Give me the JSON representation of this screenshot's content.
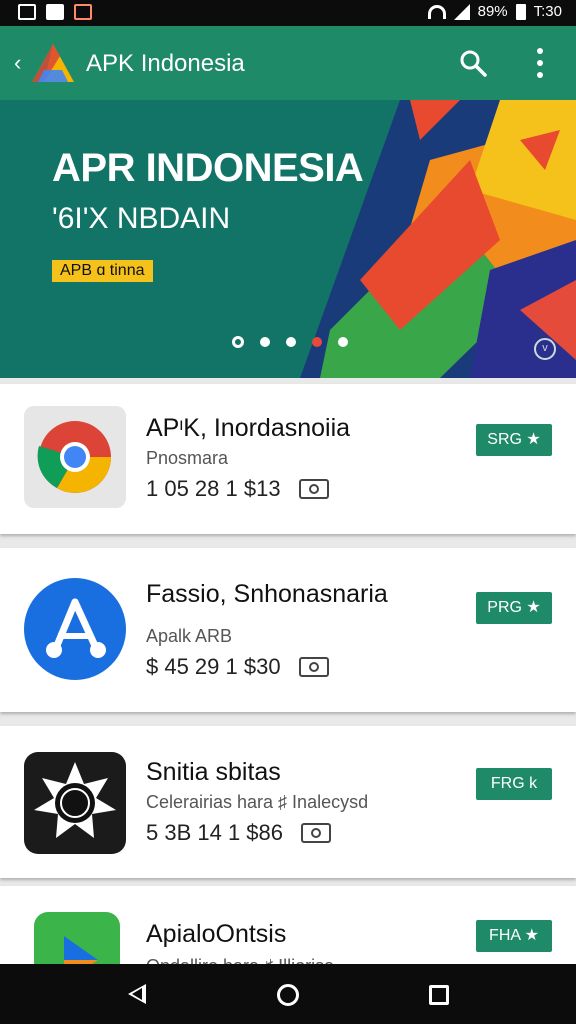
{
  "status_bar": {
    "battery": "89%",
    "time": "T:30"
  },
  "app_bar": {
    "title": "APK Indonesia"
  },
  "banner": {
    "title": "APR INDONESIA",
    "subtitle": "'6I'X NBDAIN",
    "tag": "APB ɑ tinna"
  },
  "apps": [
    {
      "name": "APᶦK, Inordasnoiia",
      "developer": "Pnosmara",
      "meta": "1 05 28 1 $13",
      "button": "SRG ★"
    },
    {
      "name": "Fassio, Snhonasnaria",
      "developer": "Apalk ARB",
      "meta": "$ 45 29 1 $30",
      "button": "PRG ★"
    },
    {
      "name": "Snitia sbitas",
      "developer": "Celerairias hara ♯ Inalecysd",
      "meta": "5 3B 14 1 $86",
      "button": "FRG k"
    },
    {
      "name": "ApialoOntsis",
      "developer": "Ondalliro hara ♯ Illiorisa",
      "meta": "",
      "button": "FHA ★"
    }
  ],
  "colors": {
    "primary": "#1f8a67",
    "banner": "#127466"
  },
  "icons": [
    "back-icon",
    "search-icon",
    "more-icon",
    "camera-icon",
    "nav-back-icon",
    "nav-home-icon",
    "nav-recent-icon"
  ]
}
